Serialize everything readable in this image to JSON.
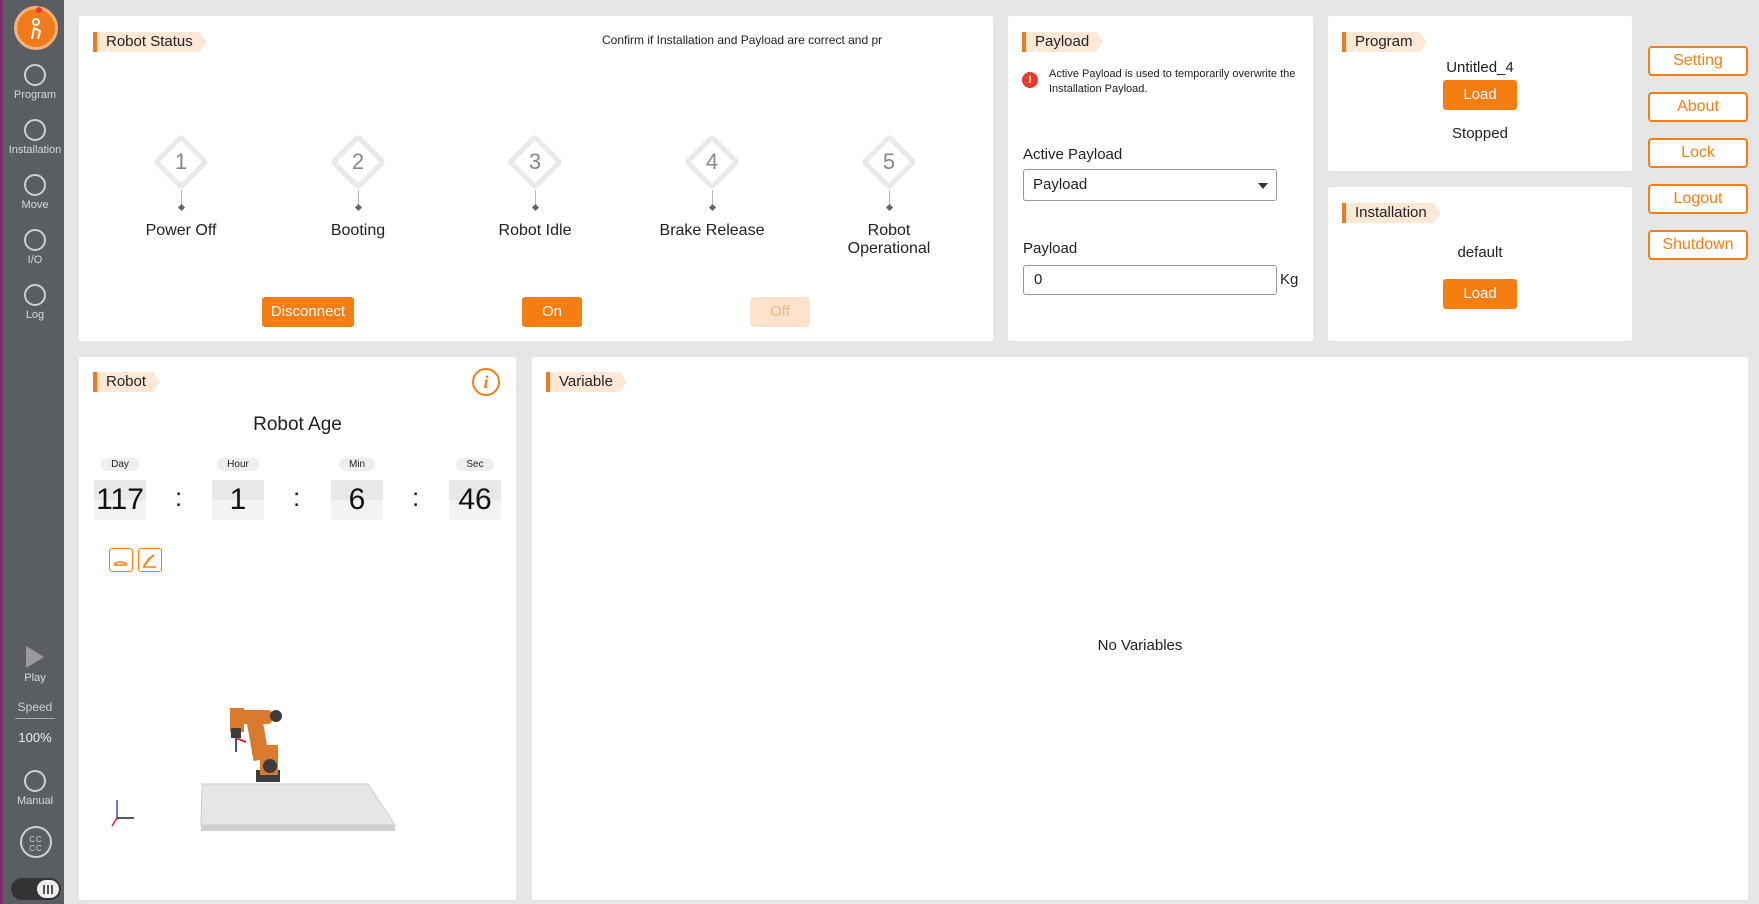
{
  "rail": {
    "items": [
      {
        "label": "Program",
        "icon": "program-icon"
      },
      {
        "label": "Installation",
        "icon": "installation-icon"
      },
      {
        "label": "Move",
        "icon": "move-icon"
      },
      {
        "label": "I/O",
        "icon": "io-icon"
      },
      {
        "label": "Log",
        "icon": "log-icon"
      }
    ],
    "play_label": "Play",
    "speed_label": "Speed",
    "speed_value": "100%",
    "manual_label": "Manual",
    "ccc_label": "CC CC"
  },
  "status": {
    "title": "Robot Status",
    "notice": "Confirm if Installation and Payload are correct and pr",
    "steps": [
      {
        "num": "1",
        "label": "Power Off"
      },
      {
        "num": "2",
        "label": "Booting"
      },
      {
        "num": "3",
        "label": "Robot Idle"
      },
      {
        "num": "4",
        "label": "Brake Release"
      },
      {
        "num": "5",
        "label": "Robot Operational"
      }
    ],
    "disconnect_label": "Disconnect",
    "on_label": "On",
    "off_label": "Off"
  },
  "payload": {
    "title": "Payload",
    "warning": "Active Payload is used to temporarily overwrite the Installation Payload.",
    "active_label": "Active Payload",
    "active_value": "Payload",
    "payload_label": "Payload",
    "payload_value": "0",
    "unit": "Kg"
  },
  "program": {
    "title": "Program",
    "name": "Untitled_4",
    "load_label": "Load",
    "state": "Stopped"
  },
  "installation": {
    "title": "Installation",
    "name": "default",
    "load_label": "Load"
  },
  "side": {
    "setting": "Setting",
    "about": "About",
    "lock": "Lock",
    "logout": "Logout",
    "shutdown": "Shutdown"
  },
  "robot": {
    "title": "Robot",
    "age_title": "Robot Age",
    "age": [
      {
        "head": "Day",
        "value": "117"
      },
      {
        "head": "Hour",
        "value": "1"
      },
      {
        "head": "Min",
        "value": "6"
      },
      {
        "head": "Sec",
        "value": "46"
      }
    ]
  },
  "variable": {
    "title": "Variable",
    "empty": "No Variables"
  },
  "colors": {
    "accent": "#f57e13",
    "rail": "#5a5e63"
  }
}
